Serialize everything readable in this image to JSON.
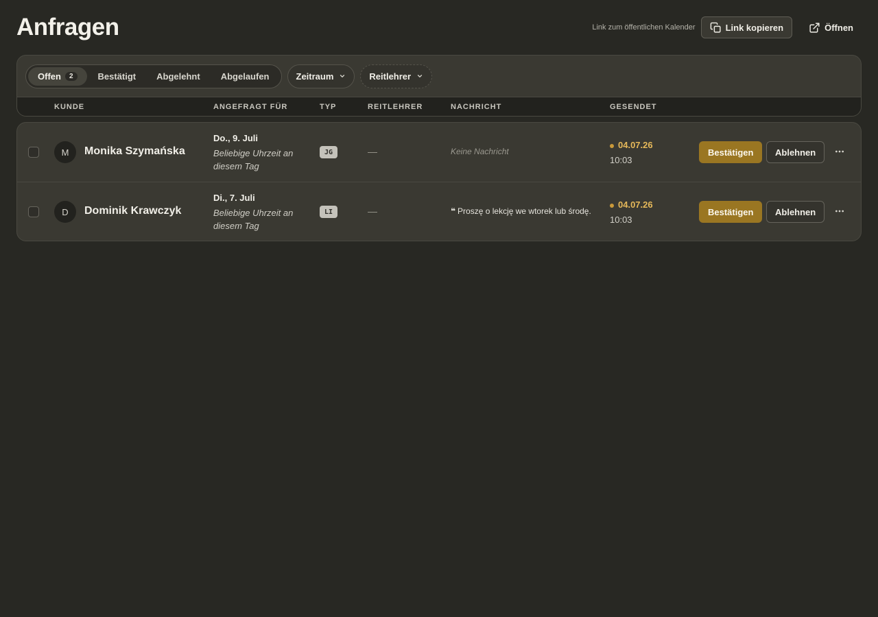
{
  "page": {
    "title": "Anfragen"
  },
  "top_actions": {
    "public_link_label": "Link zum öffentlichen Kalender",
    "copy_label": "Link kopieren",
    "open_label": "Öffnen"
  },
  "filters": {
    "tabs": [
      {
        "label": "Offen",
        "count": "2",
        "active": true
      },
      {
        "label": "Bestätigt"
      },
      {
        "label": "Abgelehnt"
      },
      {
        "label": "Abgelaufen"
      }
    ],
    "period_label": "Zeitraum",
    "teacher_label": "Reitlehrer"
  },
  "table": {
    "columns": [
      "KUNDE",
      "ANGEFRAGT FÜR",
      "TYP",
      "REITLEHRER",
      "NACHRICHT",
      "GESENDET"
    ],
    "rows": [
      {
        "initial": "M",
        "name": "Monika Szymańska",
        "date": "Do., 9. Juli",
        "time": "Beliebige Uhrzeit an diesem Tag",
        "type": "JG",
        "teacher": "—",
        "message": "Keine Nachricht",
        "sent_date": "04.07.26",
        "sent_time": "10:03",
        "confirm_label": "Bestätigen",
        "reject_label": "Ablehnen"
      },
      {
        "initial": "D",
        "name": "Dominik Krawczyk",
        "date": "Di., 7. Juli",
        "time": "Beliebige Uhrzeit an diesem Tag",
        "type": "LI",
        "teacher": "—",
        "message_quote": "❝",
        "message": "Proszę o lekcję we wtorek lub środę.",
        "sent_date": "04.07.26",
        "sent_time": "10:03",
        "confirm_label": "Bestätigen",
        "reject_label": "Ablehnen"
      }
    ]
  },
  "colors": {
    "accent": "#9a7622",
    "sent_highlight": "#e6b95a",
    "background": "#282823"
  }
}
